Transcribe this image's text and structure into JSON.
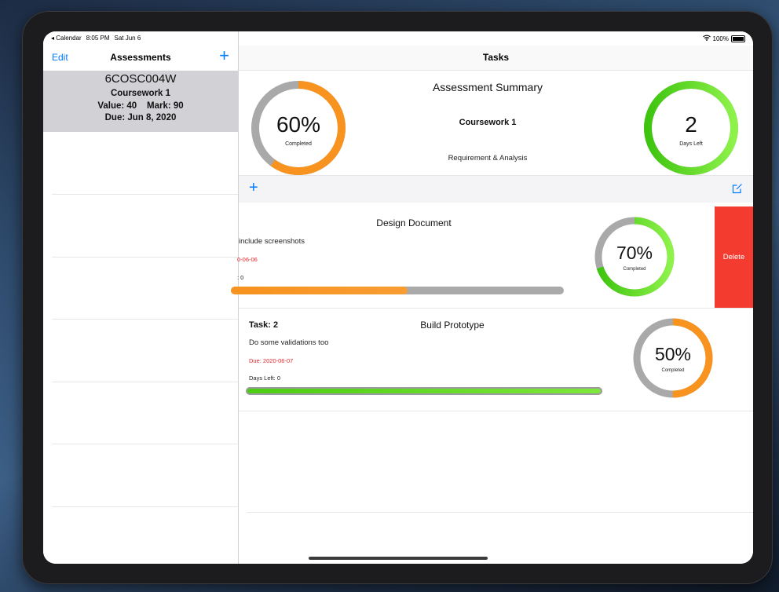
{
  "status_bar": {
    "back_app": "◂ Calendar",
    "time": "8:05 PM",
    "date": "Sat Jun 6",
    "battery": "100%"
  },
  "left_nav": {
    "edit": "Edit",
    "title": "Assessments",
    "add": "+"
  },
  "assessment": {
    "code": "6COSC004W",
    "name": "Coursework 1",
    "value_mark": "Value: 40    Mark: 90",
    "due": "Due: Jun 8, 2020"
  },
  "right_nav": {
    "title": "Tasks"
  },
  "summary": {
    "title": "Assessment Summary",
    "name": "Coursework 1",
    "description": "Requirement & Analysis",
    "progress_ring": {
      "value_text": "60%",
      "caption": "Completed",
      "percent": 60
    },
    "days_ring": {
      "value_text": "2",
      "caption": "Days Left",
      "percent": 100
    }
  },
  "toolbar": {
    "add": "+"
  },
  "tasks": [
    {
      "title": "Design Document",
      "description": "include screenshots",
      "due": "0-06-06",
      "days_left": ": 0",
      "ring": {
        "value_text": "70%",
        "caption": "Completed",
        "percent": 70
      },
      "bar_percent": 53,
      "delete": "Delete"
    },
    {
      "number": "Task: 2",
      "title": "Build Prototype",
      "description": "Do some validations too",
      "due": "Due: 2020-06-07",
      "days_left": "Days Left: 0",
      "ring": {
        "value_text": "50%",
        "caption": "Completed",
        "percent": 50
      },
      "bar_percent": 100
    }
  ],
  "colors": {
    "accent": "#007aff",
    "orange": "#f7931e",
    "green": "#5ad01d",
    "gray_track": "#a9a9a9",
    "delete": "#f43b30",
    "due_red": "#e8262d"
  }
}
